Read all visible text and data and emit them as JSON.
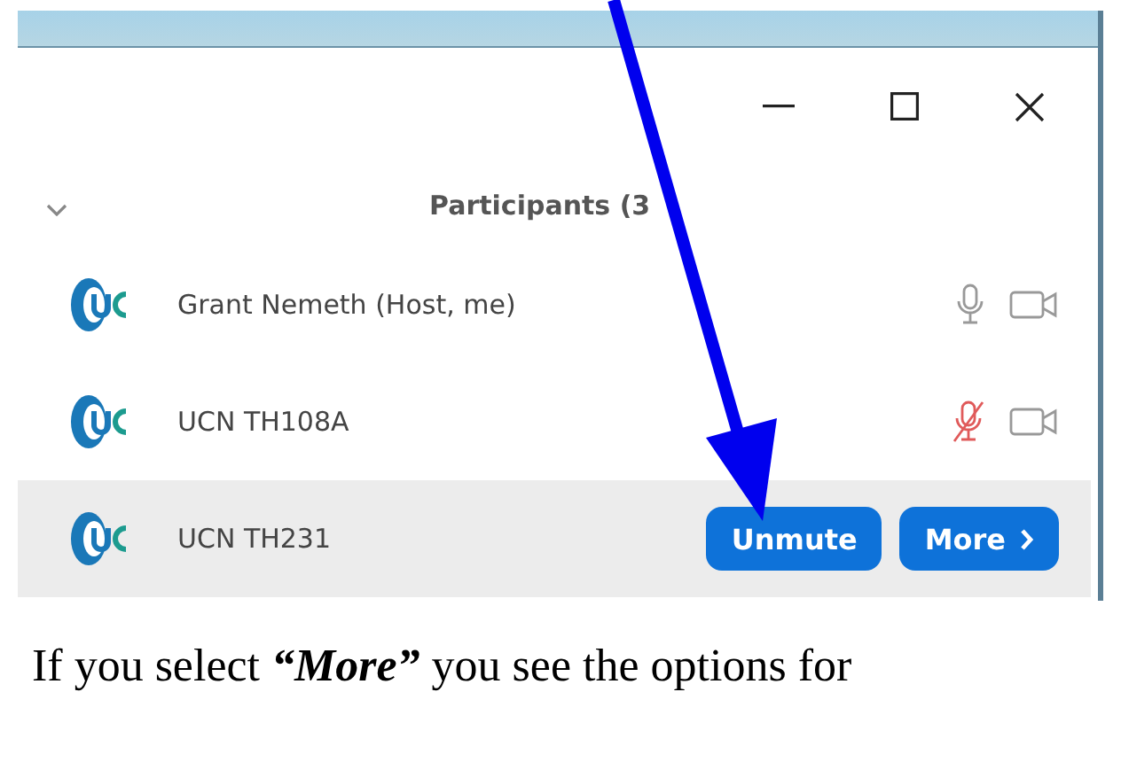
{
  "panel": {
    "title": "Participants (3"
  },
  "participants": [
    {
      "name": "Grant Nemeth (Host, me)",
      "selected": false,
      "muted": false
    },
    {
      "name": "UCN TH108A",
      "selected": false,
      "muted": true
    },
    {
      "name": "UCN TH231",
      "selected": true,
      "actions": [
        {
          "label": "Unmute",
          "kind": "plain"
        },
        {
          "label": "More",
          "kind": "chevron"
        }
      ]
    }
  ],
  "caption": "If you select **“More”** you see the options for"
}
